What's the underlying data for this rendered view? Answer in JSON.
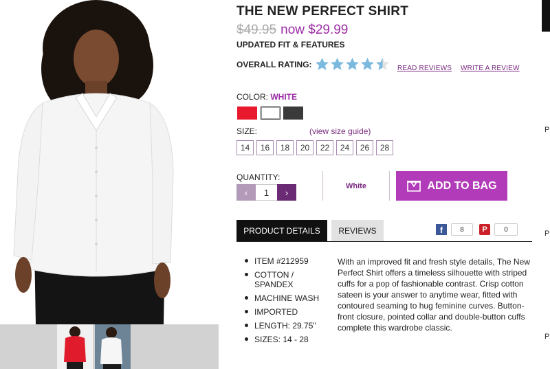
{
  "product": {
    "title": "THE NEW PERFECT SHIRT",
    "old_price": "$49.95",
    "new_price": "now $29.99",
    "subtitle": "UPDATED FIT & FEATURES"
  },
  "rating": {
    "label": "OVERALL RATING:",
    "value": 4.5,
    "max": 5,
    "star_color": "#7cb9de",
    "read_reviews": "READ REVIEWS",
    "write_review": "WRITE A REVIEW"
  },
  "color": {
    "label": "COLOR:",
    "selected": "WHITE",
    "swatches": [
      {
        "name": "red",
        "hex": "#e8192c"
      },
      {
        "name": "white",
        "hex": "#ffffff"
      },
      {
        "name": "black",
        "hex": "#3a3a3a"
      }
    ]
  },
  "size": {
    "label": "SIZE:",
    "guide_link": "(view size guide)",
    "options": [
      "14",
      "16",
      "18",
      "20",
      "22",
      "24",
      "26",
      "28"
    ]
  },
  "quantity": {
    "label": "QUANTITY:",
    "value": "1",
    "dec": "‹",
    "inc": "›"
  },
  "selected_color_display": "White",
  "add_to_bag": "ADD TO BAG",
  "tabs": {
    "details": "PRODUCT DETAILS",
    "reviews": "REVIEWS"
  },
  "social": {
    "facebook_glyph": "f",
    "facebook_count": "8",
    "pinterest_glyph": "P",
    "pinterest_count": "0"
  },
  "features": [
    "ITEM #212959",
    "COTTON / SPANDEX",
    "MACHINE WASH",
    "IMPORTED",
    "LENGTH: 29.75\"",
    "SIZES: 14 - 28"
  ],
  "description": "With an improved fit and fresh style details, The New Perfect Shirt offers a timeless silhouette with striped cuffs for a pop of fashionable contrast. Crisp cotton sateen is your answer to anytime wear, fitted with contoured seaming to hug feminine curves. Button-front closure, pointed collar and double-button cuffs complete this wardrobe classic.",
  "edge_fragments": [
    "Pl",
    "Pl",
    "Pl"
  ],
  "colors": {
    "accent": "#9b2aa4",
    "button": "#b23bb9"
  }
}
